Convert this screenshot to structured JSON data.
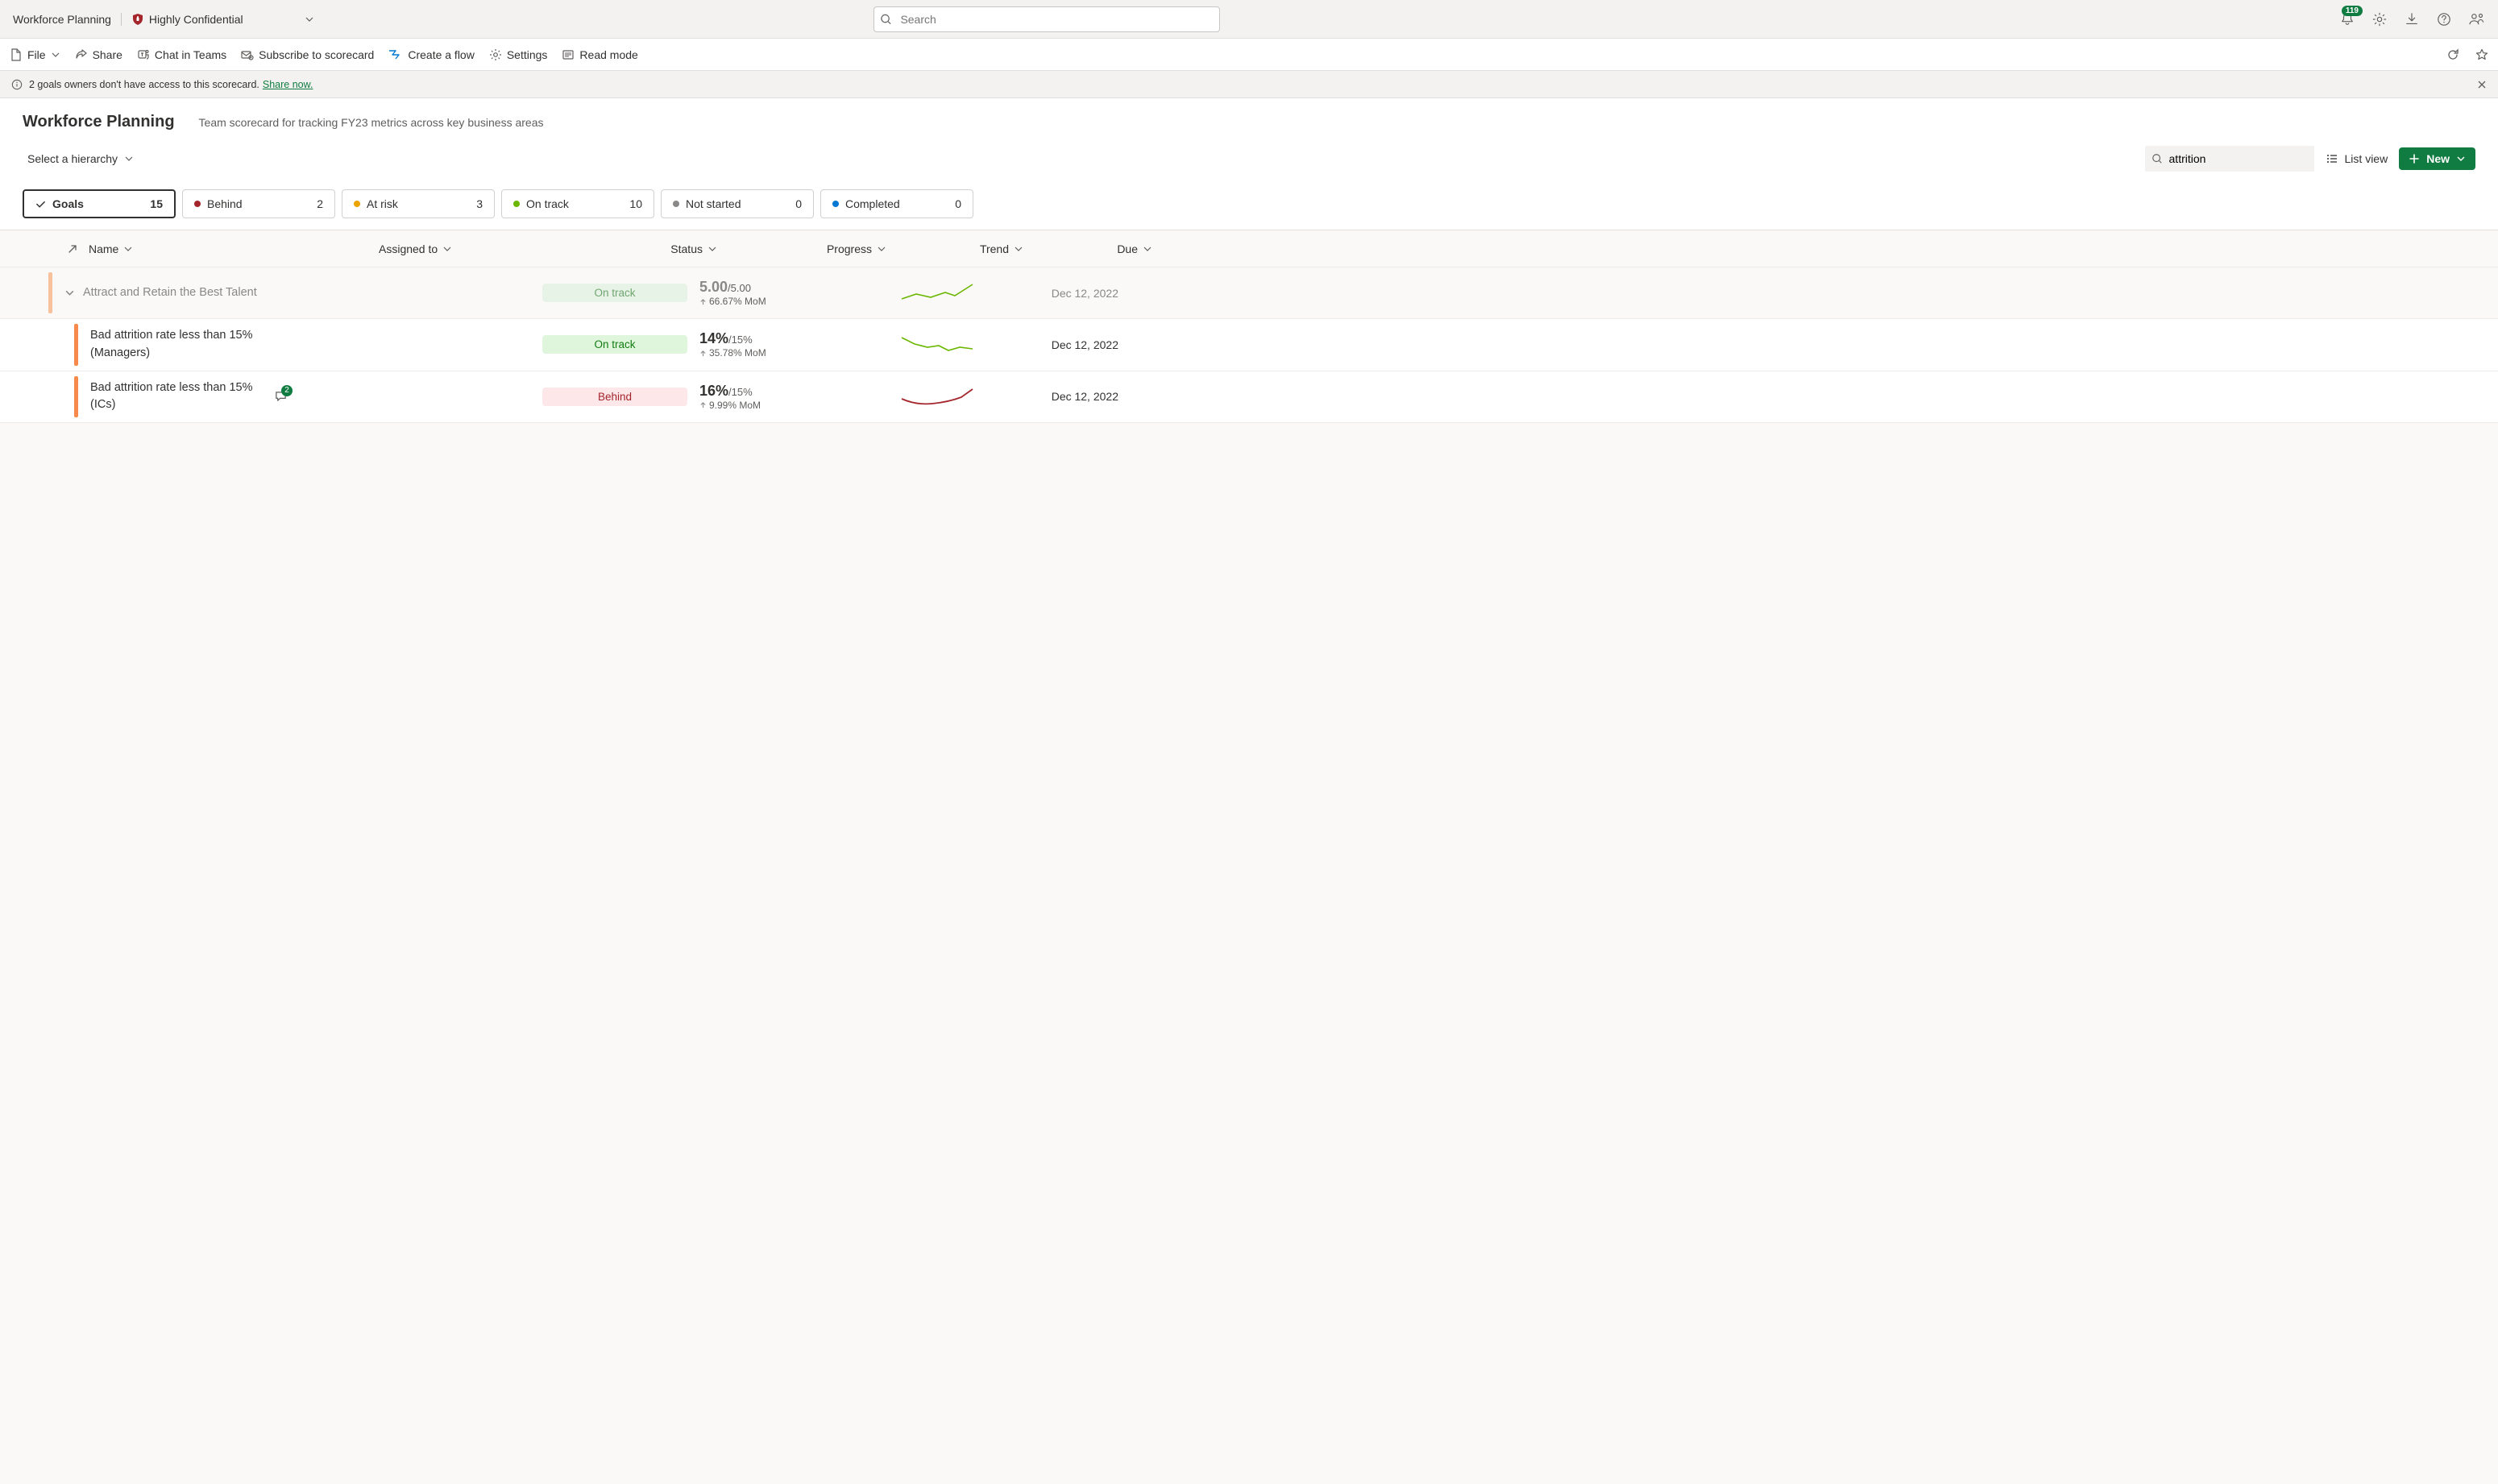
{
  "titlebar": {
    "app_title": "Workforce Planning",
    "sensitivity_label": "Highly Confidential",
    "search_placeholder": "Search",
    "notification_count": "119"
  },
  "commands": {
    "file": "File",
    "share": "Share",
    "chat": "Chat in Teams",
    "subscribe": "Subscribe to scorecard",
    "flow": "Create a flow",
    "settings": "Settings",
    "read": "Read mode"
  },
  "infobar": {
    "message": "2 goals owners don't have access to this scorecard.",
    "link": "Share now."
  },
  "page": {
    "title": "Workforce Planning",
    "description": "Team scorecard for tracking FY23 metrics across key business areas",
    "hierarchy_label": "Select a hierarchy",
    "filter_value": "attrition",
    "list_view": "List view",
    "new_button": "New"
  },
  "status_pills": [
    {
      "label": "Goals",
      "count": "15",
      "icon": "check",
      "selected": true
    },
    {
      "label": "Behind",
      "count": "2",
      "color": "#a4262c"
    },
    {
      "label": "At risk",
      "count": "3",
      "color": "#eaa300"
    },
    {
      "label": "On track",
      "count": "10",
      "color": "#6bb700"
    },
    {
      "label": "Not started",
      "count": "0",
      "color": "#8a8886"
    },
    {
      "label": "Completed",
      "count": "0",
      "color": "#0078d4"
    }
  ],
  "columns": {
    "name": "Name",
    "assigned": "Assigned to",
    "status": "Status",
    "progress": "Progress",
    "trend": "Trend",
    "due": "Due"
  },
  "rows": [
    {
      "type": "parent",
      "name": "Attract and Retain the Best Talent",
      "status": "On track",
      "status_class": "ontrack faded",
      "progress_value": "5.00",
      "progress_target": "/5.00",
      "progress_delta": "66.67% MoM",
      "trend": "up-green",
      "due": "Dec 12, 2022"
    },
    {
      "type": "child",
      "name": "Bad attrition rate less than 15% (Managers)",
      "status": "On track",
      "status_class": "ontrack",
      "progress_value": "14%",
      "progress_target": "/15%",
      "progress_delta": "35.78% MoM",
      "trend": "flat-green",
      "due": "Dec 12, 2022"
    },
    {
      "type": "child",
      "name": "Bad attrition rate less than 15% (ICs)",
      "comments": "2",
      "status": "Behind",
      "status_class": "behind",
      "progress_value": "16%",
      "progress_target": "/15%",
      "progress_delta": "9.99% MoM",
      "trend": "up-red",
      "due": "Dec 12, 2022"
    }
  ]
}
